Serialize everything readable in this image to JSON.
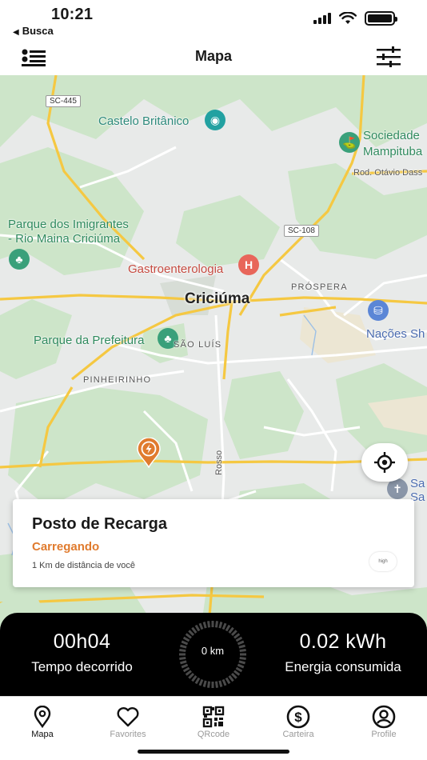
{
  "status_bar": {
    "time": "10:21",
    "back_label": "Busca"
  },
  "nav": {
    "title": "Mapa",
    "menu_icon": "list-icon",
    "filter_icon": "sliders-icon"
  },
  "map": {
    "labels": {
      "castelo": "Castelo Britânico",
      "sociedade_1": "Sociedade",
      "sociedade_2": "Mampituba",
      "rod": "Rod. Otávio Dass",
      "parque_imigrantes_1": "Parque dos Imigrantes",
      "parque_imigrantes_2": "- Rio Maina Criciúma",
      "gastro": "Gastroenterologia",
      "criciuma": "Criciúma",
      "prospera": "PRÓSPERA",
      "nacoes": "Nações Sh",
      "parque_prefeitura": "Parque da Prefeitura",
      "sao_luis": "SÃO LUÍS",
      "pinheirinho": "PINHEIRINHO",
      "rosso": "Rosso",
      "sa_1": "Sa",
      "sa_2": "Sa"
    },
    "shields": {
      "sc445": "SC-445",
      "sc108": "SC-108"
    }
  },
  "station": {
    "title": "Posto de Recarga",
    "status": "Carregando",
    "distance": "1 Km de distância de você",
    "logo_text": "high"
  },
  "charging": {
    "elapsed_value": "00h04",
    "elapsed_label": "Tempo decorrido",
    "gauge_text": "0 km",
    "energy_value": "0.02 kWh",
    "energy_label": "Energia consumida"
  },
  "tabs": [
    {
      "label": "Mapa",
      "icon": "map-pin-icon",
      "active": true
    },
    {
      "label": "Favorites",
      "icon": "heart-icon",
      "active": false
    },
    {
      "label": "QRcode",
      "icon": "qrcode-icon",
      "active": false
    },
    {
      "label": "Carteira",
      "icon": "dollar-icon",
      "active": false
    },
    {
      "label": "Profile",
      "icon": "user-icon",
      "active": false
    }
  ],
  "colors": {
    "accent_orange": "#e07b2e",
    "panel_black": "#000000",
    "map_green": "#c9e3c6"
  }
}
